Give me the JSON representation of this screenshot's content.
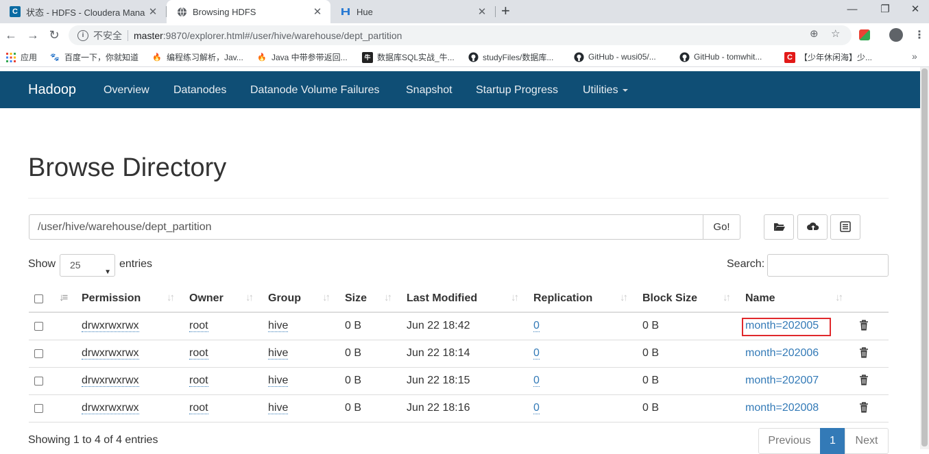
{
  "browser": {
    "tabs": [
      {
        "title": "状态 - HDFS - Cloudera Manag",
        "icon": "cloudera-icon",
        "active": false
      },
      {
        "title": "Browsing HDFS",
        "icon": "globe-icon",
        "active": true
      },
      {
        "title": "Hue",
        "icon": "hue-icon",
        "active": false
      }
    ],
    "insecure_label": "不安全",
    "url_host": "master",
    "url_path": ":9870/explorer.html#/user/hive/warehouse/dept_partition",
    "bookmarks": [
      {
        "label": "应用",
        "icon": "apps-grid-icon"
      },
      {
        "label": "百度一下，你就知道",
        "icon": "baidu-paw-icon"
      },
      {
        "label": "编程练习解析，Jav...",
        "icon": "flame-icon"
      },
      {
        "label": "Java 中带参带返回...",
        "icon": "flame-icon"
      },
      {
        "label": "数据库SQL实战_牛...",
        "icon": "nowcoder-icon"
      },
      {
        "label": "studyFiles/数据库...",
        "icon": "github-icon"
      },
      {
        "label": "GitHub - wusi05/...",
        "icon": "github-icon"
      },
      {
        "label": "GitHub - tomwhit...",
        "icon": "github-icon"
      },
      {
        "label": "【少年休闲海】少...",
        "icon": "csdn-icon"
      }
    ],
    "bookmarks_more": "»"
  },
  "navbar": {
    "brand": "Hadoop",
    "links": [
      "Overview",
      "Datanodes",
      "Datanode Volume Failures",
      "Snapshot",
      "Startup Progress"
    ],
    "utilities": "Utilities"
  },
  "page": {
    "title": "Browse Directory",
    "directory": "/user/hive/warehouse/dept_partition",
    "go_label": "Go!",
    "show_label": "Show",
    "entries_value": "25",
    "entries_label": "entries",
    "search_label": "Search:",
    "columns": [
      "Permission",
      "Owner",
      "Group",
      "Size",
      "Last Modified",
      "Replication",
      "Block Size",
      "Name"
    ],
    "rows": [
      {
        "permission": "drwxrwxrwx",
        "owner": "root",
        "group": "hive",
        "size": "0 B",
        "modified": "Jun 22 18:42",
        "replication": "0",
        "block_size": "0 B",
        "name": "month=202005",
        "highlighted": true
      },
      {
        "permission": "drwxrwxrwx",
        "owner": "root",
        "group": "hive",
        "size": "0 B",
        "modified": "Jun 22 18:14",
        "replication": "0",
        "block_size": "0 B",
        "name": "month=202006",
        "highlighted": false
      },
      {
        "permission": "drwxrwxrwx",
        "owner": "root",
        "group": "hive",
        "size": "0 B",
        "modified": "Jun 22 18:15",
        "replication": "0",
        "block_size": "0 B",
        "name": "month=202007",
        "highlighted": false
      },
      {
        "permission": "drwxrwxrwx",
        "owner": "root",
        "group": "hive",
        "size": "0 B",
        "modified": "Jun 22 18:16",
        "replication": "0",
        "block_size": "0 B",
        "name": "month=202008",
        "highlighted": false
      }
    ],
    "showing_text": "Showing 1 to 4 of 4 entries",
    "pager": {
      "previous": "Previous",
      "current": "1",
      "next": "Next"
    }
  },
  "colors": {
    "navbar": "#0f4e75",
    "link": "#337ab7",
    "highlight_box": "#e0282b"
  }
}
